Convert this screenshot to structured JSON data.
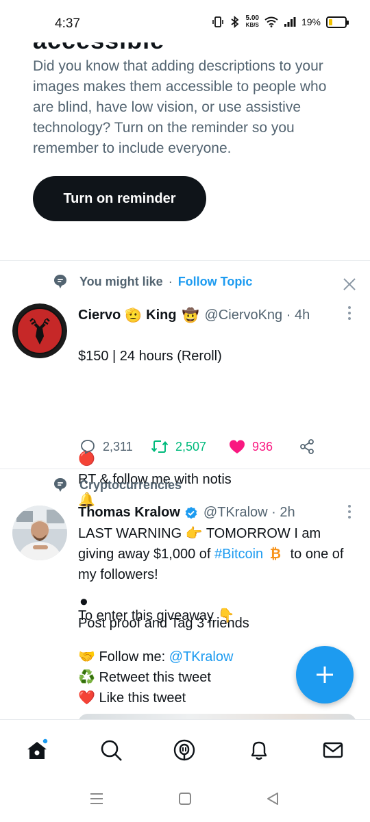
{
  "status_bar": {
    "time": "4:37",
    "speed_value": "5.00",
    "speed_unit": "KB/S",
    "battery": "19%"
  },
  "prompt": {
    "heading_fragment": "accessible",
    "body": "Did you know that adding descriptions to your images makes them accessible to people who are blind, have low vision, or use assistive technology? Turn on the reminder so you remember to include everyone.",
    "button_label": "Turn on reminder"
  },
  "tweet1": {
    "context_label": "You might like",
    "context_sep": "·",
    "context_link": "Follow Topic",
    "name_part1": "Ciervo",
    "name_emoji1": "🫡",
    "name_part2": "King",
    "name_emoji2": "🤠",
    "handle_time": "@CiervoKng · 4h",
    "line1": "$150 | 24 hours (Reroll)",
    "bullet1_emoji": "🔴",
    "bullet1": "RT & follow me with notis",
    "bullet1_trail": "🔔",
    "bullet2_emoji": "⚫",
    "bullet2": "Post proof and Tag 3 friends",
    "replies": "2,311",
    "retweets": "2,507",
    "likes": "936"
  },
  "tweet2": {
    "context_label": "Cryptocurrencies",
    "name": "Thomas Kralow",
    "handle_time": "@TKralow · 2h",
    "line1_a": "LAST WARNING",
    "line1_emoji": "👉",
    "line1_b": "TOMORROW I am giving away $1,000 of",
    "hashtag": "#Bitcoin",
    "btc_emoji": "₿",
    "line1_c": "to one of my followers!",
    "line2": "To enter this giveaway",
    "line2_emoji": "👇",
    "item1_emoji": "🤝",
    "item1": "Follow me:",
    "item1_mention": "@TKralow",
    "item2_emoji": "♻️",
    "item2": "Retweet this tweet",
    "item3_emoji": "❤️",
    "item3": "Like this tweet"
  },
  "nav": {
    "items": [
      "home-icon",
      "search-icon",
      "spaces-icon",
      "notifications-icon",
      "messages-icon"
    ]
  },
  "colors": {
    "accent": "#1d9bf0",
    "retweet": "#00ba7c",
    "like": "#f91880",
    "text_secondary": "#536471"
  }
}
